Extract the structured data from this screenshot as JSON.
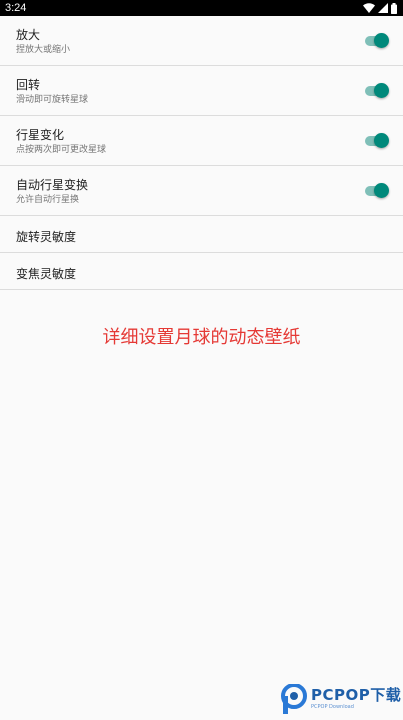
{
  "status_bar": {
    "time": "3:24",
    "icons": [
      "wifi-icon",
      "cell-signal-icon",
      "battery-icon"
    ]
  },
  "settings": [
    {
      "title": "放大",
      "summary": "捏放大或缩小",
      "switch_on": true
    },
    {
      "title": "回转",
      "summary": "滑动即可旋转星球",
      "switch_on": true
    },
    {
      "title": "行星变化",
      "summary": "点按两次即可更改星球",
      "switch_on": true
    },
    {
      "title": "自动行星变换",
      "summary": "允许自动行星换",
      "switch_on": true
    },
    {
      "title": "旋转灵敏度"
    },
    {
      "title": "变焦灵敏度"
    }
  ],
  "caption": "详细设置月球的动态壁纸",
  "watermark": {
    "main": "PCPOP下载",
    "sub": "PCPOP Download"
  },
  "colors": {
    "accent": "#00897b",
    "caption": "#e53935",
    "watermark": "#1f5fa8"
  }
}
